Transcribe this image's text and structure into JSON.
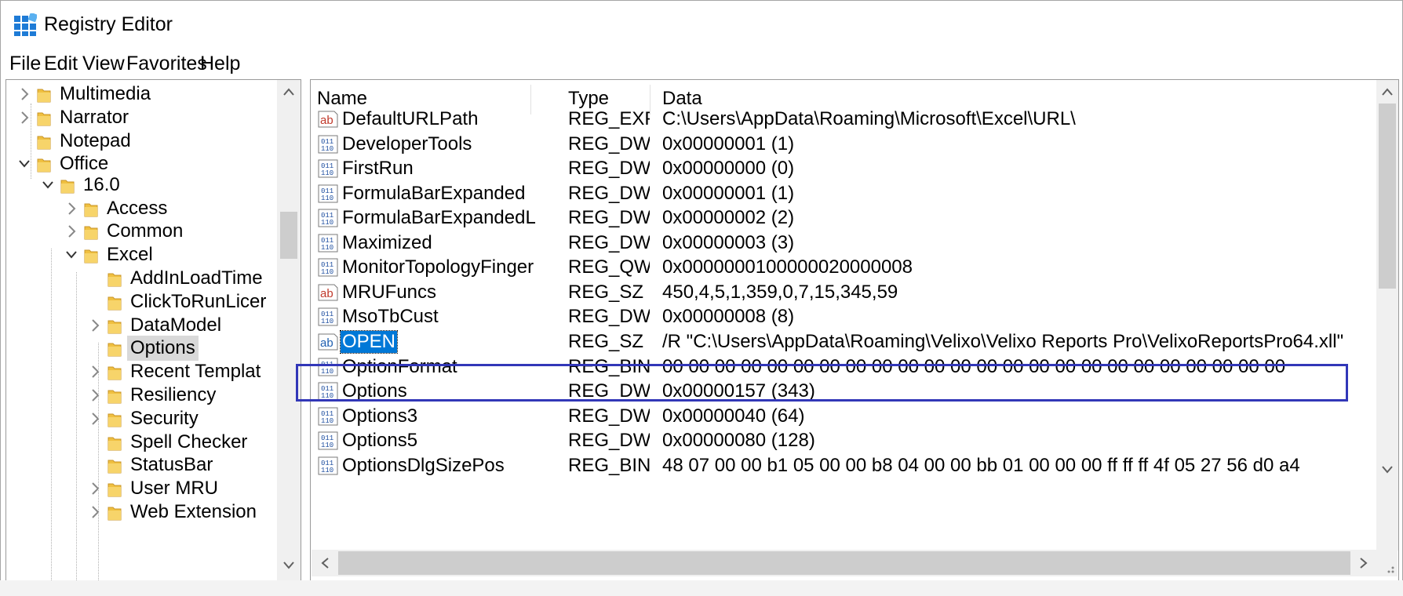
{
  "window": {
    "title": "Registry Editor"
  },
  "menu": [
    "File",
    "Edit",
    "View",
    "Favorites",
    "Help"
  ],
  "tree": [
    {
      "label": "Multimedia",
      "level": 0,
      "arrow": "right",
      "selected": false
    },
    {
      "label": "Narrator",
      "level": 0,
      "arrow": "right",
      "selected": false
    },
    {
      "label": "Notepad",
      "level": 0,
      "arrow": "none",
      "selected": false
    },
    {
      "label": "Office",
      "level": 0,
      "arrow": "down",
      "selected": false
    },
    {
      "label": "16.0",
      "level": 1,
      "arrow": "down",
      "selected": false
    },
    {
      "label": "Access",
      "level": 2,
      "arrow": "right",
      "selected": false
    },
    {
      "label": "Common",
      "level": 2,
      "arrow": "right",
      "selected": false
    },
    {
      "label": "Excel",
      "level": 2,
      "arrow": "down",
      "selected": false
    },
    {
      "label": "AddInLoadTime",
      "level": 3,
      "arrow": "none",
      "selected": false
    },
    {
      "label": "ClickToRunLicer",
      "level": 3,
      "arrow": "none",
      "selected": false
    },
    {
      "label": "DataModel",
      "level": 3,
      "arrow": "right",
      "selected": false
    },
    {
      "label": "Options",
      "level": 3,
      "arrow": "none",
      "selected": true
    },
    {
      "label": "Recent Templat",
      "level": 3,
      "arrow": "right",
      "selected": false
    },
    {
      "label": "Resiliency",
      "level": 3,
      "arrow": "right",
      "selected": false
    },
    {
      "label": "Security",
      "level": 3,
      "arrow": "right",
      "selected": false
    },
    {
      "label": "Spell Checker",
      "level": 3,
      "arrow": "none",
      "selected": false
    },
    {
      "label": "StatusBar",
      "level": 3,
      "arrow": "none",
      "selected": false
    },
    {
      "label": "User MRU",
      "level": 3,
      "arrow": "right",
      "selected": false
    },
    {
      "label": "Web Extension",
      "level": 3,
      "arrow": "right",
      "selected": false
    }
  ],
  "columns": {
    "name": "Name",
    "type": "Type",
    "data": "Data"
  },
  "values": [
    {
      "icon": "string-value-icon",
      "name": "DefaultURLPath",
      "type": "REG_EXP...",
      "data": "C:\\Users\\AppData\\Roaming\\Microsoft\\Excel\\URL\\",
      "selected": false
    },
    {
      "icon": "binary-value-icon",
      "name": "DeveloperTools",
      "type": "REG_DW",
      "data": "0x00000001 (1)",
      "selected": false
    },
    {
      "icon": "binary-value-icon",
      "name": "FirstRun",
      "type": "REG_DW",
      "data": "0x00000000 (0)",
      "selected": false
    },
    {
      "icon": "binary-value-icon",
      "name": "FormulaBarExpanded",
      "type": "REG_DW",
      "data": "0x00000001 (1)",
      "selected": false
    },
    {
      "icon": "binary-value-icon",
      "name": "FormulaBarExpandedLir",
      "type": "REG_DW",
      "data": "0x00000002 (2)",
      "selected": false
    },
    {
      "icon": "binary-value-icon",
      "name": "Maximized",
      "type": "REG_DW",
      "data": "0x00000003 (3)",
      "selected": false
    },
    {
      "icon": "binary-value-icon",
      "name": "MonitorTopologyFinger",
      "type": "REG_QW",
      "data": "0x0000000100000020000008",
      "selected": false
    },
    {
      "icon": "string-value-icon",
      "name": "MRUFuncs",
      "type": "REG_SZ",
      "data": "450,4,5,1,359,0,7,15,345,59",
      "selected": false
    },
    {
      "icon": "binary-value-icon",
      "name": "MsoTbCust",
      "type": "REG_DW",
      "data": "0x00000008 (8)",
      "selected": false
    },
    {
      "icon": "string-value-icon",
      "name": "OPEN",
      "type": "REG_SZ",
      "data": "/R \"C:\\Users\\AppData\\Roaming\\Velixo\\Velixo Reports Pro\\VelixoReportsPro64.xll\"",
      "selected": true
    },
    {
      "icon": "binary-value-icon",
      "name": "OptionFormat",
      "type": "REG_BIN",
      "data": "00 00 00 00 00 00 00 00 00 00 00 00 00 00 00 00 00 00 00 00 00 00 00 00",
      "selected": false
    },
    {
      "icon": "binary-value-icon",
      "name": "Options",
      "type": "REG_DW",
      "data": "0x00000157 (343)",
      "selected": false
    },
    {
      "icon": "binary-value-icon",
      "name": "Options3",
      "type": "REG_DW",
      "data": "0x00000040 (64)",
      "selected": false
    },
    {
      "icon": "binary-value-icon",
      "name": "Options5",
      "type": "REG_DW",
      "data": "0x00000080 (128)",
      "selected": false
    },
    {
      "icon": "binary-value-icon",
      "name": "OptionsDlgSizePos",
      "type": "REG_BIN",
      "data": "48 07 00 00 b1 05 00 00 b8 04 00 00 bb 01 00 00 00 ff ff ff 4f 05 27 56 d0 a4",
      "selected": false
    }
  ],
  "colors": {
    "selection": "#0078d7",
    "highlight_box": "#3237b8",
    "folder": "#f0c040"
  }
}
